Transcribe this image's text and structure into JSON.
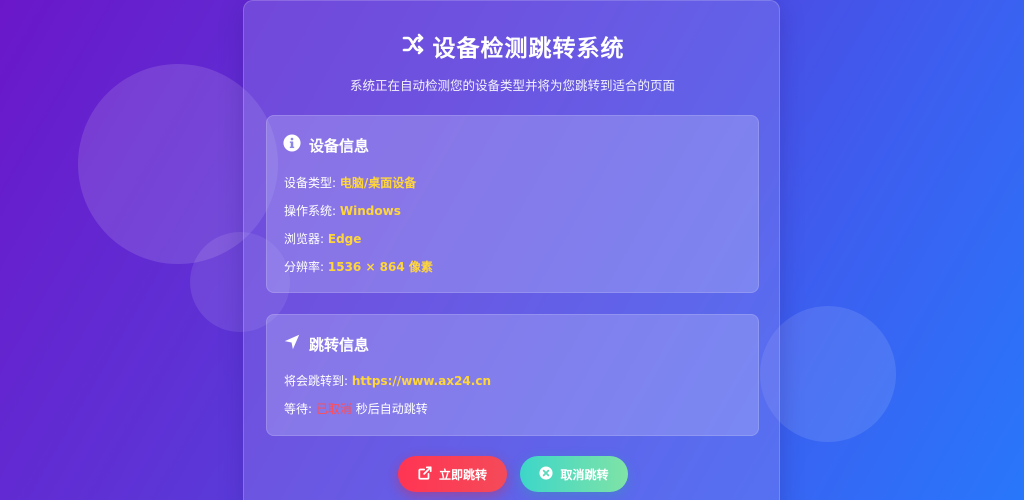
{
  "header": {
    "title": "设备检测跳转系统",
    "subtitle": "系统正在自动检测您的设备类型并将为您跳转到适合的页面",
    "icon": "shuffle-icon"
  },
  "device_info": {
    "title": "设备信息",
    "icon": "info-circle-icon",
    "device_type_label": "设备类型:",
    "device_type_value": "电脑/桌面设备",
    "os_label": "操作系统:",
    "os_value": "Windows",
    "browser_label": "浏览器:",
    "browser_value": "Edge",
    "resolution_label": "分辨率:",
    "resolution_value": "1536 × 864 像素"
  },
  "redirect_info": {
    "title": "跳转信息",
    "icon": "location-arrow-icon",
    "target_label": "将会跳转到:",
    "target_value": "https://www.ax24.cn",
    "wait_label": "等待:",
    "wait_value": "已取消",
    "wait_suffix": "秒后自动跳转"
  },
  "buttons": {
    "go_label": "立即跳转",
    "go_icon": "external-link-icon",
    "cancel_label": "取消跳转",
    "cancel_icon": "times-circle-icon"
  },
  "colors": {
    "accent_value": "#ffd63a",
    "cancel_text": "#ff4d57",
    "go_button": "#ff3553",
    "cancel_button": "#3dd6c9"
  }
}
